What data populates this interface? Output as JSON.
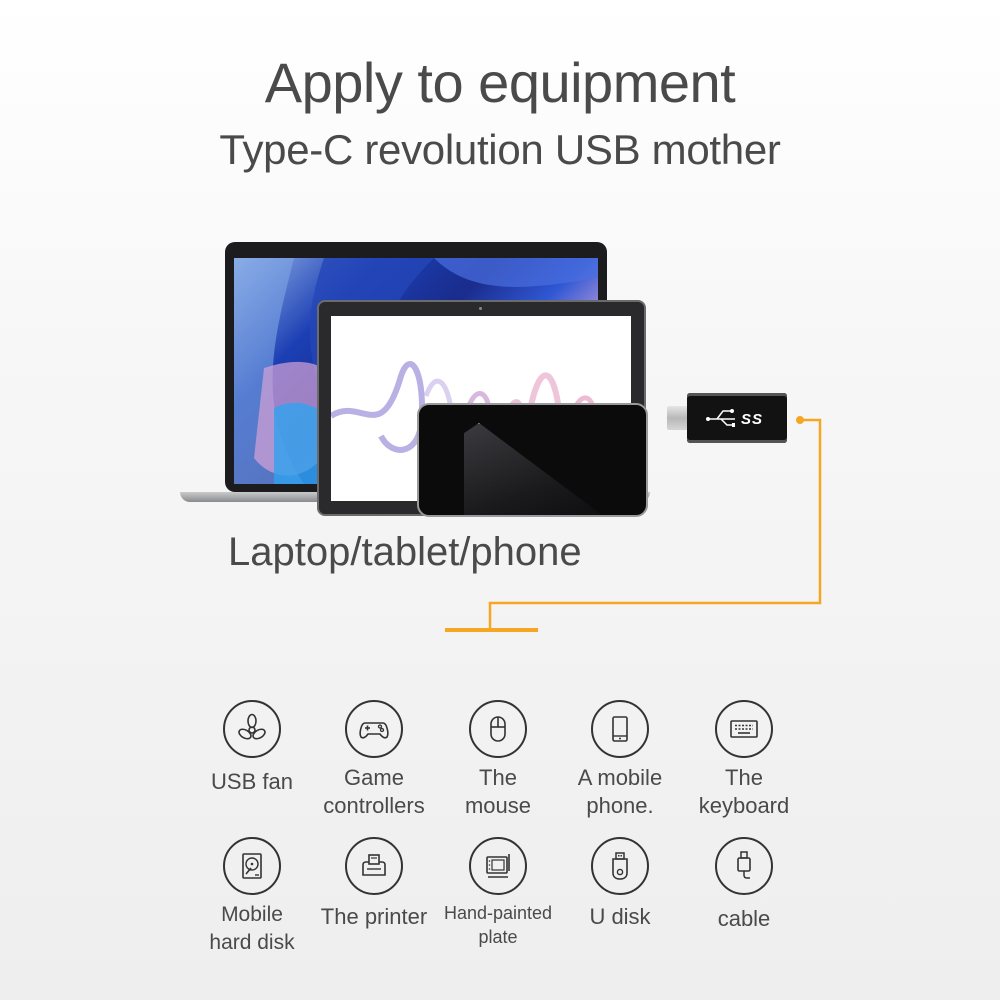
{
  "header": {
    "title": "Apply to equipment",
    "subtitle": "Type-C revolution USB mother"
  },
  "hero": {
    "devices_label": "Laptop/tablet/phone",
    "adapter_logo_text": "SS",
    "adapter_icon": "usb-superspeed-icon",
    "accent_color": "#f5a623"
  },
  "applications": [
    {
      "label": "USB fan",
      "icon": "fan-icon"
    },
    {
      "label": "Game controllers",
      "icon": "gamepad-icon"
    },
    {
      "label": "The mouse",
      "icon": "mouse-icon"
    },
    {
      "label": "A mobile phone.",
      "icon": "mobile-phone-icon"
    },
    {
      "label": "The keyboard",
      "icon": "keyboard-icon"
    },
    {
      "label": "Mobile hard disk",
      "icon": "hard-disk-icon"
    },
    {
      "label": "The printer",
      "icon": "printer-icon"
    },
    {
      "label": "Hand-painted plate",
      "icon": "drawing-tablet-icon"
    },
    {
      "label": "U disk",
      "icon": "usb-flash-drive-icon"
    },
    {
      "label": "cable",
      "icon": "usb-cable-icon"
    }
  ]
}
